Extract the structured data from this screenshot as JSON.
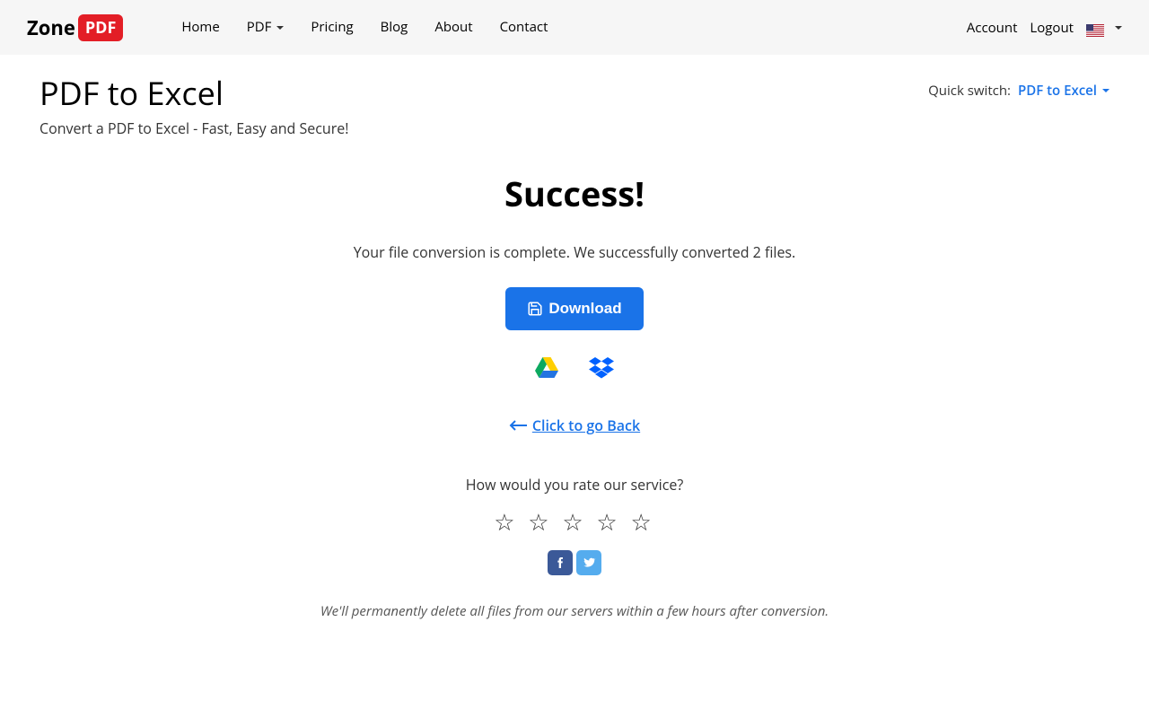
{
  "logo": {
    "text": "Zone",
    "badge": "PDF"
  },
  "nav": {
    "home": "Home",
    "pdf": "PDF",
    "pricing": "Pricing",
    "blog": "Blog",
    "about": "About",
    "contact": "Contact"
  },
  "headerRight": {
    "account": "Account",
    "logout": "Logout"
  },
  "page": {
    "title": "PDF to Excel",
    "subtitle": "Convert a PDF to Excel - Fast, Easy and Secure!"
  },
  "quickSwitch": {
    "label": "Quick switch:",
    "value": "PDF to Excel"
  },
  "main": {
    "heading": "Success!",
    "message": "Your file conversion is complete. We successfully converted 2 files.",
    "download": "Download",
    "backLink": "Click to go Back",
    "ratePrompt": "How would you rate our service?",
    "footnote": "We'll permanently delete all files from our servers within a few hours after conversion."
  }
}
